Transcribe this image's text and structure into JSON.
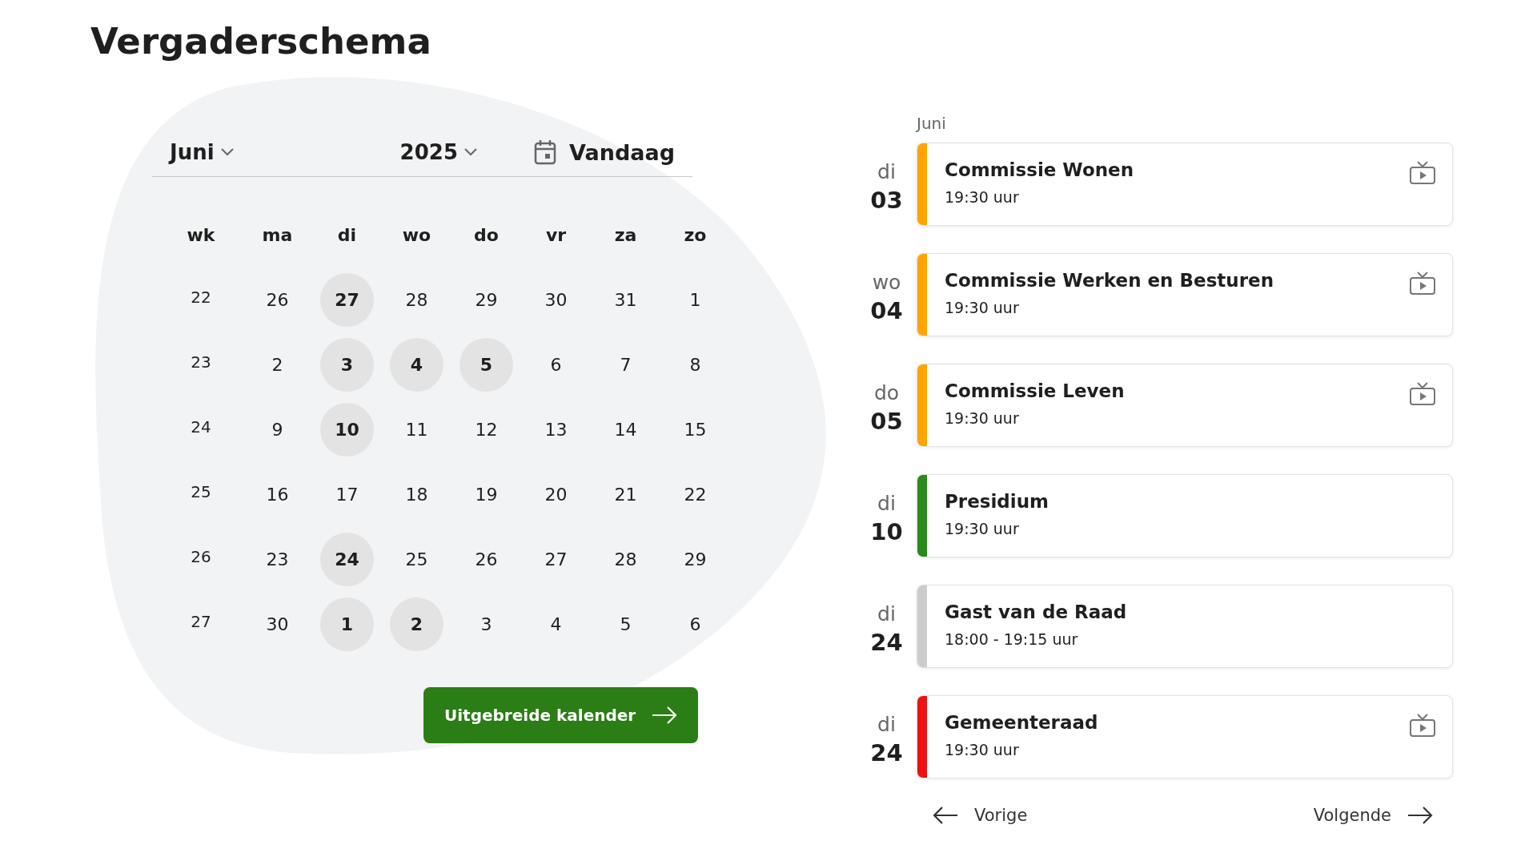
{
  "title": "Vergaderschema",
  "calendar": {
    "month": "Juni",
    "year": "2025",
    "today": "Vandaag",
    "columns": [
      "wk",
      "ma",
      "di",
      "wo",
      "do",
      "vr",
      "za",
      "zo"
    ],
    "weeks": [
      {
        "number": "22",
        "days": [
          {
            "label": "26",
            "event": false
          },
          {
            "label": "27",
            "event": true
          },
          {
            "label": "28",
            "event": false
          },
          {
            "label": "29",
            "event": false
          },
          {
            "label": "30",
            "event": false
          },
          {
            "label": "31",
            "event": false
          },
          {
            "label": "1",
            "event": false
          }
        ]
      },
      {
        "number": "23",
        "days": [
          {
            "label": "2",
            "event": false
          },
          {
            "label": "3",
            "event": true
          },
          {
            "label": "4",
            "event": true
          },
          {
            "label": "5",
            "event": true
          },
          {
            "label": "6",
            "event": false
          },
          {
            "label": "7",
            "event": false
          },
          {
            "label": "8",
            "event": false
          }
        ]
      },
      {
        "number": "24",
        "days": [
          {
            "label": "9",
            "event": false
          },
          {
            "label": "10",
            "event": true
          },
          {
            "label": "11",
            "event": false
          },
          {
            "label": "12",
            "event": false
          },
          {
            "label": "13",
            "event": false
          },
          {
            "label": "14",
            "event": false
          },
          {
            "label": "15",
            "event": false
          }
        ]
      },
      {
        "number": "25",
        "days": [
          {
            "label": "16",
            "event": false
          },
          {
            "label": "17",
            "event": false
          },
          {
            "label": "18",
            "event": false
          },
          {
            "label": "19",
            "event": false
          },
          {
            "label": "20",
            "event": false
          },
          {
            "label": "21",
            "event": false
          },
          {
            "label": "22",
            "event": false
          }
        ]
      },
      {
        "number": "26",
        "days": [
          {
            "label": "23",
            "event": false
          },
          {
            "label": "24",
            "event": true
          },
          {
            "label": "25",
            "event": false
          },
          {
            "label": "26",
            "event": false
          },
          {
            "label": "27",
            "event": false
          },
          {
            "label": "28",
            "event": false
          },
          {
            "label": "29",
            "event": false
          }
        ]
      },
      {
        "number": "27",
        "days": [
          {
            "label": "30",
            "event": false
          },
          {
            "label": "1",
            "event": true
          },
          {
            "label": "2",
            "event": true
          },
          {
            "label": "3",
            "event": false
          },
          {
            "label": "4",
            "event": false
          },
          {
            "label": "5",
            "event": false
          },
          {
            "label": "6",
            "event": false
          }
        ]
      }
    ],
    "button": "Uitgebreide kalender"
  },
  "agenda": {
    "month": "Juni",
    "events": [
      {
        "weekday": "di",
        "day": "03",
        "title": "Commissie Wonen",
        "time": "19:30 uur",
        "color": "#ffa500",
        "stream": true
      },
      {
        "weekday": "wo",
        "day": "04",
        "title": "Commissie Werken en Besturen",
        "time": "19:30 uur",
        "color": "#ffa500",
        "stream": true
      },
      {
        "weekday": "do",
        "day": "05",
        "title": "Commissie Leven",
        "time": "19:30 uur",
        "color": "#ffa500",
        "stream": true
      },
      {
        "weekday": "di",
        "day": "10",
        "title": "Presidium",
        "time": "19:30 uur",
        "color": "#2a8a1a",
        "stream": false
      },
      {
        "weekday": "di",
        "day": "24",
        "title": "Gast van de Raad",
        "time": "18:00 - 19:15 uur",
        "color": "#cccccc",
        "stream": false
      },
      {
        "weekday": "di",
        "day": "24",
        "title": "Gemeenteraad",
        "time": "19:30 uur",
        "color": "#ee1111",
        "stream": true
      }
    ],
    "prev": "Vorige",
    "next": "Volgende"
  }
}
